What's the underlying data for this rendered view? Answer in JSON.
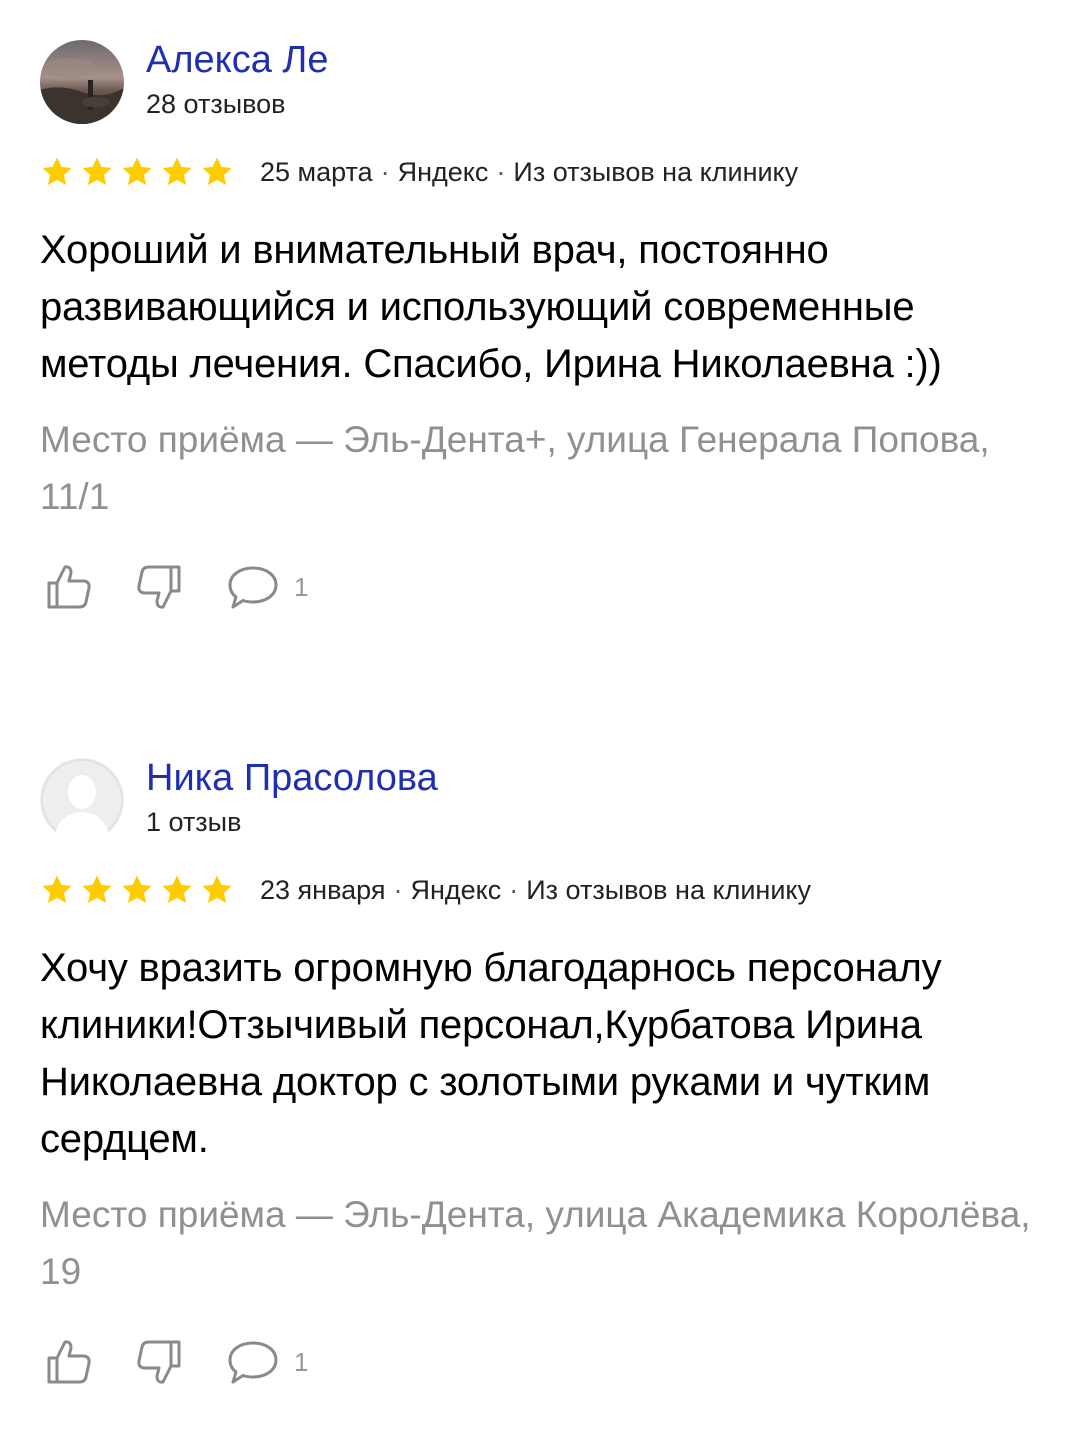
{
  "colors": {
    "author_link": "#1f2fb0",
    "star": "#ffcc00",
    "place_text": "#909090",
    "icon_stroke": "#8a8a8a"
  },
  "reviews": [
    {
      "author": "Алекса Ле",
      "review_count": "28 отзывов",
      "rating": 5,
      "date": "25 марта",
      "source": "Яндекс",
      "origin": "Из отзывов на клинику",
      "text": "Хороший и внимательный врач, постоянно развивающийся и использующий современные методы лечения. Спасибо, Ирина Николаевна :))",
      "place": "Место приёма — Эль-Дента+, улица Генерала Попова, 11/1",
      "comments": "1",
      "icons": [
        "avatar-photo",
        "thumbs-up-icon",
        "thumbs-down-icon",
        "comment-icon"
      ]
    },
    {
      "author": "Ника Прасолова",
      "review_count": "1 отзыв",
      "rating": 5,
      "date": "23 января",
      "source": "Яндекс",
      "origin": "Из отзывов на клинику",
      "text": "Хочу вразить огромную благодарнось персоналу клиники!Отзычивый персонал,Курбатова Ирина Николаевна доктор с золотыми руками и чутким сердцем.",
      "place": "Место приёма — Эль-Дента, улица Академика Королёва, 19",
      "comments": "1",
      "icons": [
        "default-avatar",
        "thumbs-up-icon",
        "thumbs-down-icon",
        "comment-icon"
      ]
    }
  ]
}
